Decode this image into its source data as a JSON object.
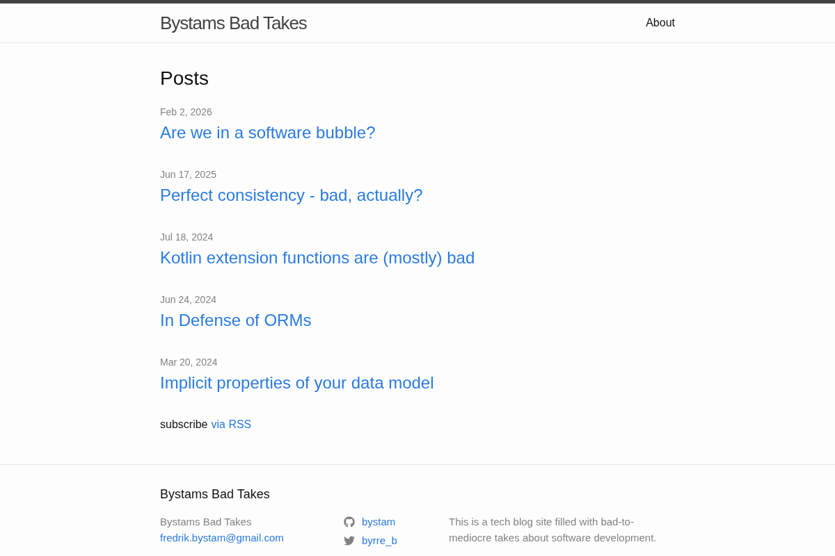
{
  "header": {
    "site_title": "Bystams Bad Takes",
    "nav": [
      {
        "label": "About"
      }
    ]
  },
  "main": {
    "heading": "Posts",
    "posts": [
      {
        "date": "Feb 2, 2026",
        "title": "Are we in a software bubble?"
      },
      {
        "date": "Jun 17, 2025",
        "title": "Perfect consistency - bad, actually?"
      },
      {
        "date": "Jul 18, 2024",
        "title": "Kotlin extension functions are (mostly) bad"
      },
      {
        "date": "Jun 24, 2024",
        "title": "In Defense of ORMs"
      },
      {
        "date": "Mar 20, 2024",
        "title": "Implicit properties of your data model"
      }
    ],
    "subscribe": {
      "text": "subscribe",
      "link": "via RSS"
    }
  },
  "footer": {
    "heading": "Bystams Bad Takes",
    "name": "Bystams Bad Takes",
    "email": "fredrik.bystam@gmail.com",
    "social": [
      {
        "kind": "github",
        "username": "bystam"
      },
      {
        "kind": "twitter",
        "username": "byrre_b"
      }
    ],
    "description": "This is a tech blog site filled with bad-to-mediocre takes about software development."
  }
}
